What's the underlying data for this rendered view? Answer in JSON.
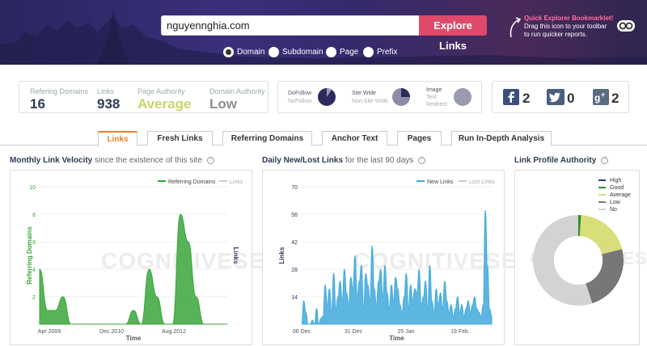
{
  "search": {
    "value": "nguyennghia.com",
    "button": "Explore Links"
  },
  "bookmarklet": {
    "title": "Quick Explorer Bookmarklet!",
    "text": "Drag this icon to your toolbar to run quicker reports."
  },
  "scope_options": [
    {
      "label": "Domain",
      "selected": true
    },
    {
      "label": "Subdomain",
      "selected": false
    },
    {
      "label": "Page",
      "selected": false
    },
    {
      "label": "Prefix",
      "selected": false
    }
  ],
  "stats": {
    "referring_domains": {
      "label": "Refering Domains",
      "value": "16"
    },
    "links": {
      "label": "Links",
      "value": "938"
    },
    "page_authority": {
      "label": "Page Authority",
      "value": "Average",
      "color": "#cbd46a"
    },
    "domain_authority": {
      "label": "Domain Authority",
      "value": "Low",
      "color": "#8a8f95"
    }
  },
  "link_types": {
    "follow": {
      "label": "DoFollow",
      "sub": "NoFollow"
    },
    "site": {
      "label": "Site Wide",
      "sub": "Non Site Wide"
    },
    "media": {
      "label": "Image",
      "sub1": "Text",
      "sub2": "Redirect"
    }
  },
  "social": {
    "facebook": "2",
    "twitter": "0",
    "googleplus": "2"
  },
  "tabs": [
    "Links",
    "Fresh Links",
    "Referring Domains",
    "Anchor Text",
    "Pages",
    "Run In-Depth Analysis"
  ],
  "panels": {
    "velocity": {
      "title": "Monthly Link Velocity",
      "sub": "since the existence of this site"
    },
    "daily": {
      "title": "Daily New/Lost Links",
      "sub": "for the last 90 days"
    },
    "authority": {
      "title": "Link Profile Authority"
    }
  },
  "watermark": "COGNITIVESEO",
  "chart_data": [
    {
      "type": "area",
      "title": "Monthly Link Velocity",
      "xlabel": "Time",
      "ylabel": "Referring Domains",
      "y2label": "Links",
      "ylim": [
        0,
        10
      ],
      "yticks": [
        "2",
        "4",
        "6",
        "8",
        "10"
      ],
      "xticks": [
        "Apr 2009",
        "Dec 2010",
        "Aug 2012"
      ],
      "legend": [
        "Referring Domains",
        "Links"
      ],
      "series": [
        {
          "name": "Referring Domains",
          "color": "#3aa63a",
          "x": [
            "Apr 2009",
            "May 2009",
            "Jun 2009",
            "Jul 2009",
            "Aug 2009",
            "Sep 2009",
            "Oct 2009",
            "Nov 2009",
            "Dec 2009",
            "2010",
            "Dec 2010",
            "2011",
            "Aug 2012",
            "Mar 2013",
            "Apr 2013",
            "May 2013",
            "Jun 2013",
            "Jul 2013",
            "Aug 2013",
            "Sep 2013",
            "Oct 2013",
            "Nov 2013",
            "Dec 2013",
            "Jan 2014",
            "Feb 2014"
          ],
          "values": [
            4,
            1,
            1,
            2,
            0,
            0,
            0,
            0,
            0,
            0,
            0,
            0,
            1,
            0,
            4,
            2,
            0,
            0,
            8,
            6,
            2,
            0,
            0,
            0,
            0
          ]
        }
      ]
    },
    {
      "type": "area",
      "title": "Daily New/Lost Links",
      "xlabel": "Time",
      "ylabel": "Links",
      "ylim": [
        0,
        70
      ],
      "yticks": [
        "14",
        "28",
        "42",
        "56",
        "70"
      ],
      "xticks": [
        "06 Dec",
        "31 Dec",
        "25 Jan",
        "19 Feb"
      ],
      "legend": [
        "New Links",
        "Lost Links"
      ],
      "series": [
        {
          "name": "New Links",
          "color": "#3fa9dc",
          "values": [
            0,
            12,
            6,
            0,
            0,
            2,
            0,
            8,
            0,
            3,
            4,
            20,
            10,
            18,
            6,
            26,
            8,
            14,
            22,
            12,
            28,
            16,
            10,
            24,
            18,
            35,
            14,
            22,
            30,
            8,
            26,
            20,
            12,
            40,
            18,
            10,
            22,
            28,
            14,
            30,
            16,
            8,
            20,
            12,
            24,
            18,
            10,
            6,
            14,
            26,
            8,
            20,
            12,
            18,
            16,
            28,
            10,
            14,
            22,
            8,
            30,
            12,
            6,
            18,
            10,
            16,
            8,
            22,
            12,
            6,
            10,
            4,
            8,
            14,
            6,
            10,
            4,
            8,
            12,
            6,
            10,
            14,
            8,
            6,
            4,
            10,
            58,
            30,
            8,
            4
          ]
        }
      ]
    },
    {
      "type": "pie",
      "title": "Link Profile Authority",
      "legend": [
        {
          "name": "High",
          "color": "#2a3a8a",
          "value": 0
        },
        {
          "name": "Good",
          "color": "#2f8a2f",
          "value": 1
        },
        {
          "name": "Average",
          "color": "#d8df7a",
          "value": 20
        },
        {
          "name": "Low",
          "color": "#777777",
          "value": 24
        },
        {
          "name": "No",
          "color": "#d3d3d3",
          "value": 55
        }
      ]
    }
  ]
}
